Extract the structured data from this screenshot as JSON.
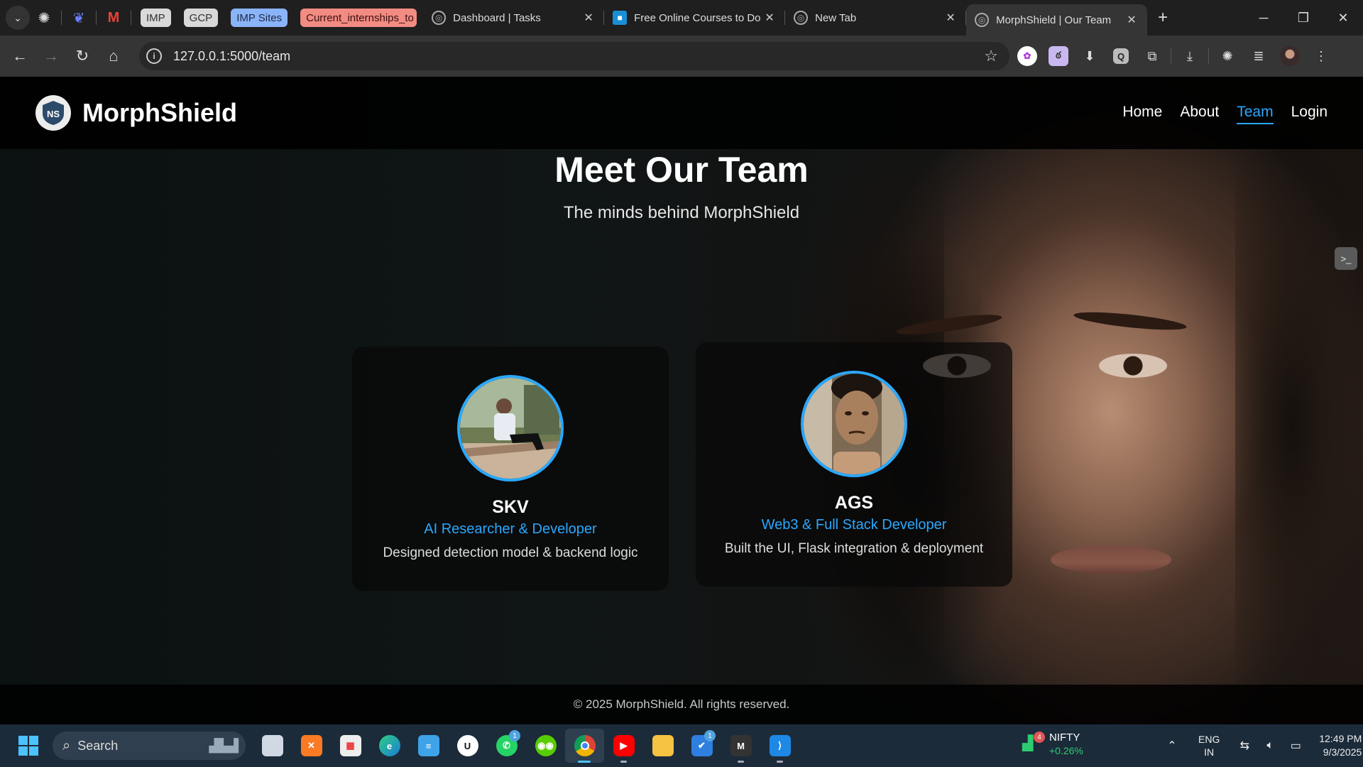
{
  "browser": {
    "pinned_chips": [
      "IMP",
      "GCP",
      "IMP Sites",
      "Current_internships_to"
    ],
    "tabs": [
      {
        "label": "Dashboard | Tasks",
        "active": false
      },
      {
        "label": "Free Online Courses to Do",
        "active": false
      },
      {
        "label": "New Tab",
        "active": false
      },
      {
        "label": "MorphShield | Our Team",
        "active": true
      }
    ],
    "url": "127.0.0.1:5000/team",
    "extension_q": "Q"
  },
  "site": {
    "brand": "MorphShield",
    "logo_text": "NS",
    "nav": [
      {
        "label": "Home",
        "active": false
      },
      {
        "label": "About",
        "active": false
      },
      {
        "label": "Team",
        "active": true
      },
      {
        "label": "Login",
        "active": false
      }
    ],
    "title": "Meet Our Team",
    "subtitle": "The minds behind MorphShield",
    "accent": "#2aa8ff",
    "team": [
      {
        "name": "SKV",
        "role": "AI Researcher & Developer",
        "desc": "Designed detection model & backend logic"
      },
      {
        "name": "AGS",
        "role": "Web3 & Full Stack Developer",
        "desc": "Built the UI, Flask integration & deployment"
      }
    ],
    "footer": "© 2025 MorphShield. All rights reserved."
  },
  "taskbar": {
    "search": "Search",
    "whatsapp_badge": "1",
    "todo_badge": "1",
    "app_m": "M",
    "nifty_label": "NIFTY",
    "nifty_change": "+0.26%",
    "nifty_badge": "4",
    "lang1": "ENG",
    "lang2": "IN",
    "time": "12:49 PM",
    "date": "9/3/2025"
  }
}
